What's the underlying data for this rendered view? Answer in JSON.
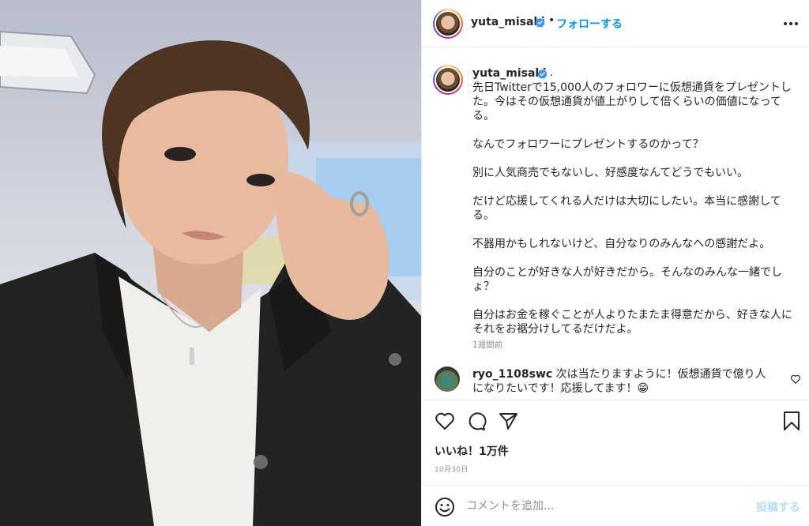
{
  "post": {
    "image_alt": "selfie photo",
    "header": {
      "username": "yuta_misaki",
      "verified": true,
      "separator": "•",
      "follow_label": "フォローする",
      "more_icon": "more-horizontal-icon"
    },
    "caption": {
      "username": "yuta_misaki",
      "trailing": ".",
      "paragraphs": [
        "先日Twitterで15,000人のフォロワーに仮想通貨をプレゼントした。今はその仮想通貨が値上がりして倍くらいの価値になってる。",
        "なんでフォロワーにプレゼントするのかって？",
        "別に人気商売でもないし、好感度なんてどうでもいい。",
        "だけど応援してくれる人だけは大切にしたい。本当に感謝してる。",
        "不器用かもしれないけど、自分なりのみんなへの感謝だよ。",
        "自分のことが好きな人が好きだから。そんなのみんな一緒でしょ？",
        "自分はお金を稼ぐことが人よりたまたま得意だから、好きな人にそれをお裾分けしてるだけだよ。"
      ],
      "time_ago": "1週間前"
    },
    "comments": [
      {
        "username": "ryo_1108swc",
        "text": "次は当たりますように！仮想通貨で億り人になりたいです！応援してます！😁"
      }
    ],
    "actions": {
      "like_icon": "heart-icon",
      "comment_icon": "comment-icon",
      "share_icon": "share-icon",
      "save_icon": "bookmark-icon"
    },
    "likes_text": "いいね！1万件",
    "date_text": "10月30日",
    "add_comment": {
      "placeholder": "コメントを追加...",
      "post_label": "投稿する",
      "emoji_icon": "smiley-icon"
    }
  },
  "colors": {
    "link_blue": "#0095f6",
    "post_disabled": "#b2dffc",
    "muted": "#8e8e8e",
    "border": "#efefef"
  }
}
